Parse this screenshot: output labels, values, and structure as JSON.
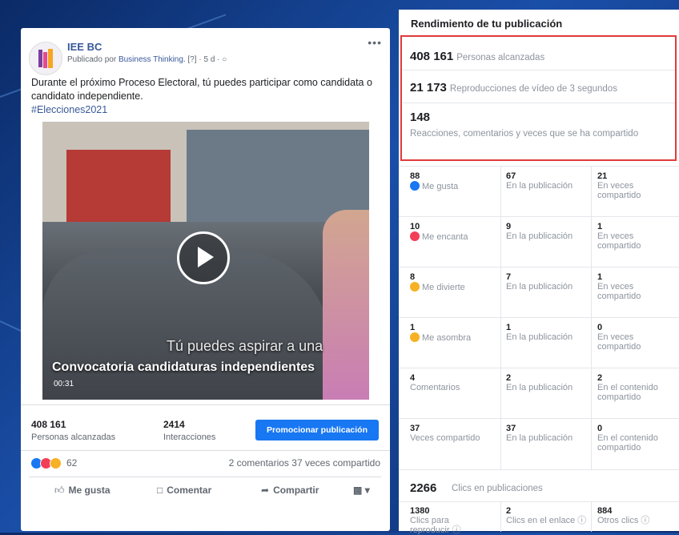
{
  "post": {
    "page_name": "IEE BC",
    "published_by_label": "Publicado por",
    "published_by": "Business Thinking.",
    "meta": "[?] · 5 d ·",
    "text": "Durante el próximo Proceso Electoral, tú puedes participar como candidata o candidato independiente.",
    "hashtag": "#Elecciones2021",
    "video": {
      "caption": "Convocatoria candidaturas independientes",
      "overlay_text": "Tú puedes aspirar a una",
      "duration": "00:31"
    },
    "stats": {
      "reach_value": "408 161",
      "reach_label": "Personas alcanzadas",
      "interactions_value": "2414",
      "interactions_label": "Interacciones",
      "promote_label": "Promocionar publicación"
    },
    "reactions_count": "62",
    "summary": "2 comentarios 37 veces compartido",
    "actions": {
      "like": "Me gusta",
      "comment": "Comentar",
      "share": "Compartir"
    },
    "colors": {
      "link": "#385898",
      "primary": "#1877f2",
      "highlight": "#e03b3b"
    }
  },
  "panel": {
    "title": "Rendimiento de tu publicación",
    "reach_value": "408 161",
    "reach_label": "Personas alcanzadas",
    "plays_value": "21 173",
    "plays_label": "Reproducciones de vídeo de 3 segundos",
    "engagement_value": "148",
    "engagement_label": "Reacciones, comentarios y veces que se ha compartido",
    "rows": [
      {
        "total": "88",
        "label": "Me gusta",
        "on_post": "67",
        "on_post_label": "En la publicación",
        "shared": "21",
        "shared_label": "En veces compartido"
      },
      {
        "total": "10",
        "label": "Me encanta",
        "on_post": "9",
        "on_post_label": "En la publicación",
        "shared": "1",
        "shared_label": "En veces compartido"
      },
      {
        "total": "8",
        "label": "Me divierte",
        "on_post": "7",
        "on_post_label": "En la publicación",
        "shared": "1",
        "shared_label": "En veces compartido"
      },
      {
        "total": "1",
        "label": "Me asombra",
        "on_post": "1",
        "on_post_label": "En la publicación",
        "shared": "0",
        "shared_label": "En veces compartido"
      },
      {
        "total": "4",
        "label": "Comentarios",
        "on_post": "2",
        "on_post_label": "En la publicación",
        "shared": "2",
        "shared_label": "En el contenido compartido"
      },
      {
        "total": "37",
        "label": "Veces compartido",
        "on_post": "37",
        "on_post_label": "En la publicación",
        "shared": "0",
        "shared_label": "En el contenido compartido"
      }
    ],
    "clicks_value": "2266",
    "clicks_label": "Clics en publicaciones",
    "clicks": [
      {
        "value": "1380",
        "label": "Clics para reproducir"
      },
      {
        "value": "2",
        "label": "Clics en el enlace"
      },
      {
        "value": "884",
        "label": "Otros clics"
      }
    ]
  }
}
